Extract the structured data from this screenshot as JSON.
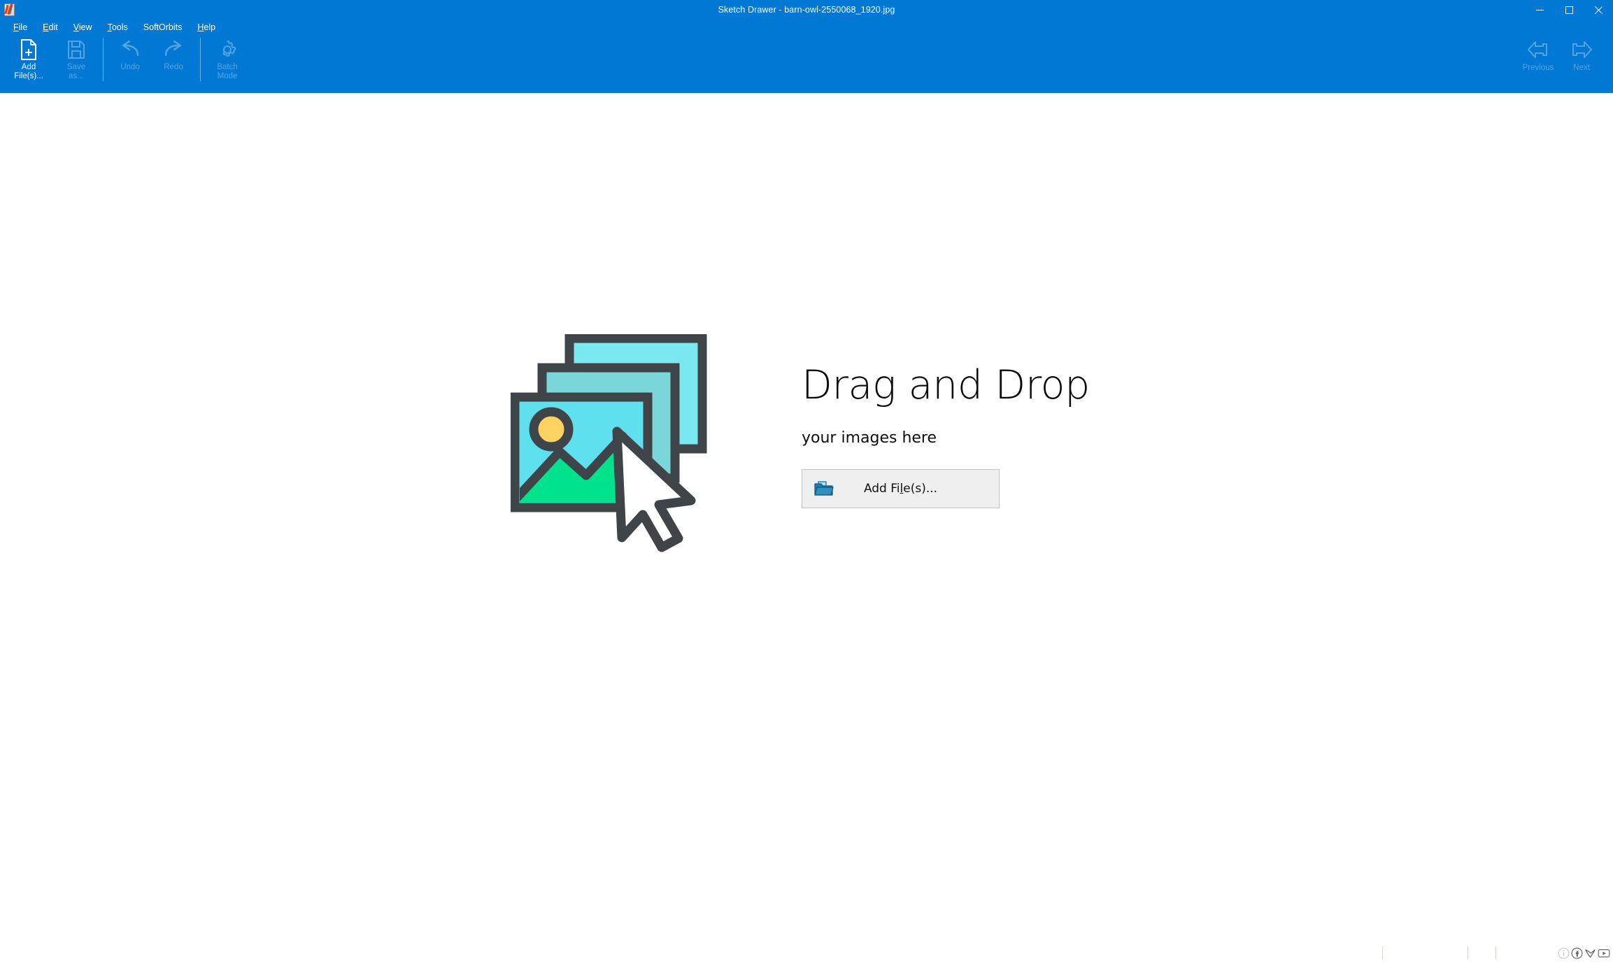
{
  "window": {
    "title": "Sketch Drawer - barn-owl-2550068_1920.jpg",
    "app_icon": "sketch-drawer-app-icon",
    "controls": {
      "minimize": "minimize-icon",
      "maximize": "maximize-icon",
      "close": "close-icon"
    },
    "titlebar_color": "#0078d4"
  },
  "menubar": {
    "items": [
      {
        "label": "File",
        "mnemonic": "F"
      },
      {
        "label": "Edit",
        "mnemonic": "E"
      },
      {
        "label": "View",
        "mnemonic": "V"
      },
      {
        "label": "Tools",
        "mnemonic": "T"
      },
      {
        "label": "SoftOrbits",
        "mnemonic": ""
      },
      {
        "label": "Help",
        "mnemonic": "H"
      }
    ]
  },
  "toolbar": {
    "buttons": [
      {
        "label": "Add\nFile(s)...",
        "icon": "add-file-icon",
        "enabled": true
      },
      {
        "label": "Save\nas...",
        "icon": "save-as-icon",
        "enabled": false
      },
      {
        "label": "Undo",
        "icon": "undo-icon",
        "enabled": false
      },
      {
        "label": "Redo",
        "icon": "redo-icon",
        "enabled": false
      },
      {
        "label": "Batch\nMode",
        "icon": "batch-mode-icon",
        "enabled": false
      }
    ],
    "navigation": [
      {
        "label": "Previous",
        "icon": "arrow-left-icon",
        "enabled": false
      },
      {
        "label": "Next",
        "icon": "arrow-right-icon",
        "enabled": false
      }
    ]
  },
  "main": {
    "dropzone": {
      "illustration": "image-stack-with-cursor-icon",
      "title": "Drag and Drop",
      "subtitle": "your images here",
      "add_button": {
        "label_before": "Add Fi",
        "label_mnemonic": "l",
        "label_after": "e(s)...",
        "full_label": "Add File(s)...",
        "icon": "open-folder-icon"
      }
    }
  },
  "statusbar": {
    "cells": [
      "",
      "",
      "",
      ""
    ],
    "icons": [
      {
        "name": "info-icon",
        "glyph": "i"
      },
      {
        "name": "facebook-icon",
        "glyph": "f"
      },
      {
        "name": "twitter-icon",
        "glyph": "t"
      },
      {
        "name": "youtube-icon",
        "glyph": "▶"
      }
    ]
  },
  "colors": {
    "accent": "#0078d4",
    "art_outline": "#3f4448",
    "art_cyan_front": "#5fe0ef",
    "art_cyan_mid": "#7ad6d9",
    "art_cyan_back": "#79e8f0",
    "art_green": "#00e28c",
    "art_sun": "#fcd263",
    "cursor_white": "#ffffff",
    "button_face": "#efefef"
  }
}
